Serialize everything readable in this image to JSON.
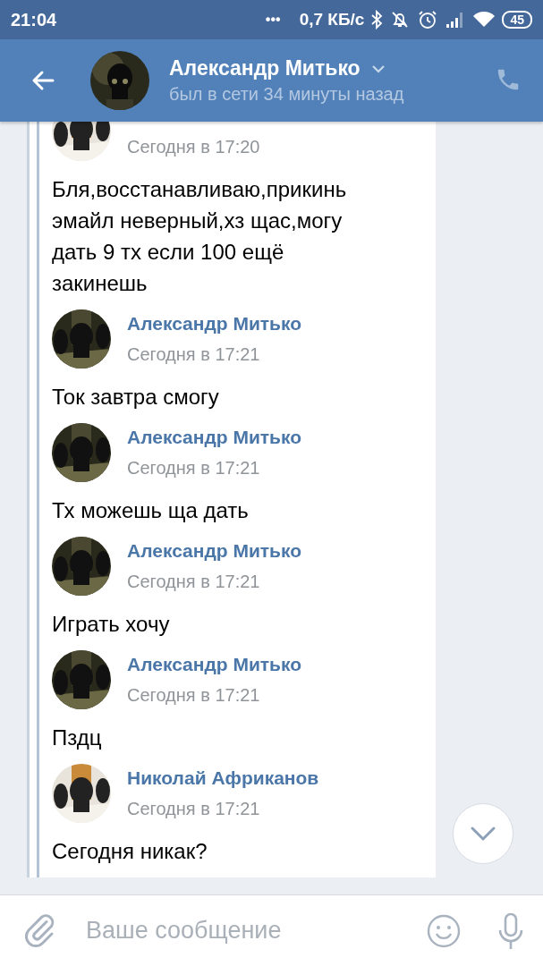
{
  "status_bar": {
    "time": "21:04",
    "more": "•••",
    "speed": "0,7 КБ/с",
    "battery": "45"
  },
  "header": {
    "title": "Александр Митько",
    "subtitle": "был в сети 34 минуты назад"
  },
  "messages": [
    {
      "time": "Сегодня в 17:20",
      "text": "Бля,восстанавливаю,прикинь эмайл неверный,хз щас,могу дать 9 тх если 100 ещё закинешь",
      "avatar": {
        "kind": "light"
      }
    },
    {
      "sender": "Александр Митько",
      "time": "Сегодня в 17:21",
      "text": "Ток завтра смогу",
      "avatar": {
        "kind": "dark"
      }
    },
    {
      "sender": "Александр Митько",
      "time": "Сегодня в 17:21",
      "text": "Тх можешь ща дать",
      "avatar": {
        "kind": "dark"
      }
    },
    {
      "sender": "Александр Митько",
      "time": "Сегодня в 17:21",
      "text": "Играть хочу",
      "avatar": {
        "kind": "dark"
      }
    },
    {
      "sender": "Александр Митько",
      "time": "Сегодня в 17:21",
      "text": "Пздц",
      "avatar": {
        "kind": "dark"
      }
    },
    {
      "sender": "Николай Африканов",
      "time": "Сегодня в 17:21",
      "text": "Сегодня никак?",
      "avatar": {
        "kind": "light"
      }
    }
  ],
  "composer": {
    "placeholder": "Ваше сообщение"
  }
}
